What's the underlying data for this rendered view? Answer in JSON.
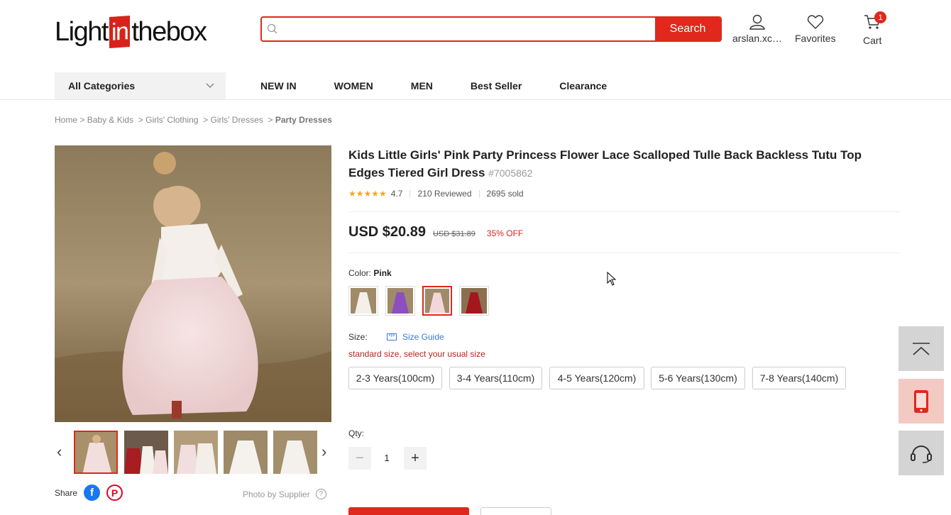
{
  "header": {
    "logo": {
      "pre": "Light",
      "box": "in",
      "post": "thebox"
    },
    "search": {
      "placeholder": "",
      "button": "Search"
    },
    "account": "arslan.xc…",
    "favorites": "Favorites",
    "cart": {
      "label": "Cart",
      "count": "1"
    },
    "icons": {
      "search": "magnifier-icon",
      "account": "user-icon",
      "favorites": "heart-icon",
      "cart": "cart-icon"
    }
  },
  "nav": {
    "categories": "All Categories",
    "links": [
      "NEW IN",
      "WOMEN",
      "MEN",
      "Best Seller",
      "Clearance"
    ]
  },
  "breadcrumb": {
    "items": [
      "Home",
      "Baby & Kids",
      "Girls' Clothing",
      "Girls' Dresses"
    ],
    "current": "Party Dresses",
    "separator": ">"
  },
  "gallery": {
    "share_label": "Share",
    "share_icons": [
      "facebook-icon",
      "pinterest-icon"
    ],
    "photo_note": "Photo by Supplier",
    "help": "?"
  },
  "product": {
    "title": "Kids Little Girls' Pink Party Princess Flower Lace Scalloped Tulle Back Backless Tutu Top Edges Tiered Girl Dress",
    "sku": "#7005862",
    "stars": "★★★★★",
    "rating": "4.7",
    "reviews": "210 Reviewed",
    "sold": "2695 sold",
    "price": "USD $20.89",
    "old_price": "USD $31.89",
    "discount": "35% OFF",
    "color_label": "Color:",
    "color_value": "Pink",
    "swatch_colors": [
      "#f4efe9",
      "#8c4ec0",
      "#f3d6d9",
      "#a4171c"
    ],
    "size_label": "Size:",
    "size_guide": "Size Guide",
    "size_note": "standard size, select your usual size",
    "sizes": [
      "2-3 Years(100cm)",
      "3-4 Years(110cm)",
      "4-5 Years(120cm)",
      "5-6 Years(130cm)",
      "7-8 Years(140cm)"
    ],
    "qty_label": "Qty:",
    "qty": "1",
    "minus": "−",
    "plus": "+"
  },
  "colors": {
    "accent": "#e0281c",
    "link": "#3a7bd5",
    "star": "#f5a623"
  }
}
